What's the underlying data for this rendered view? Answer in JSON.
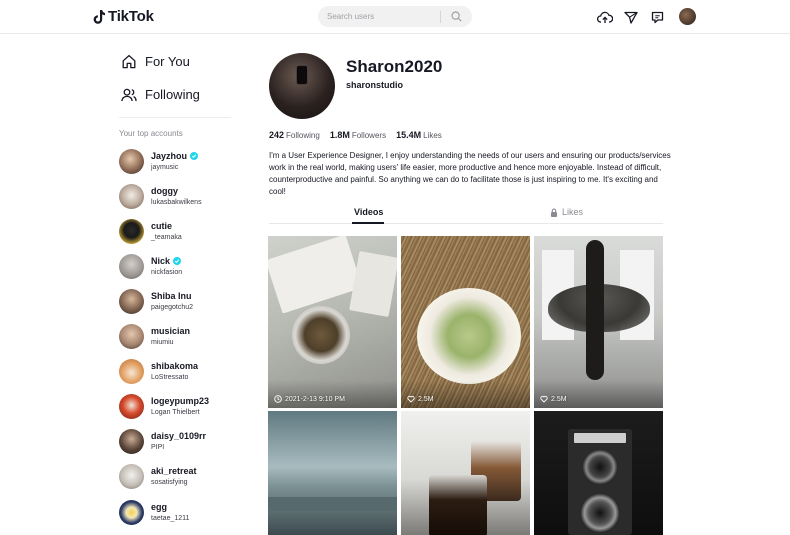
{
  "header": {
    "logo_text": "TikTok",
    "search_placeholder": "Search users",
    "icons": [
      "upload-icon",
      "inbox-send-icon",
      "messages-icon"
    ]
  },
  "sidebar": {
    "nav": [
      {
        "label": "For You",
        "icon": "home-icon"
      },
      {
        "label": "Following",
        "icon": "following-icon"
      }
    ],
    "top_accounts_title": "Your top accounts",
    "accounts": [
      {
        "name": "Jayzhou",
        "handle": "jaymusic",
        "verified": true
      },
      {
        "name": "doggy",
        "handle": "lukasbakwilkens",
        "verified": false
      },
      {
        "name": "cutie",
        "handle": "_teamaka",
        "verified": false
      },
      {
        "name": "Nick",
        "handle": "nickfasion",
        "verified": true
      },
      {
        "name": "Shiba Inu",
        "handle": "paigegotchu2",
        "verified": false
      },
      {
        "name": "musician",
        "handle": "miumiu",
        "verified": false
      },
      {
        "name": "shibakoma",
        "handle": "LoStressato",
        "verified": false
      },
      {
        "name": "logeypump23",
        "handle": "Logan Thielbert",
        "verified": false
      },
      {
        "name": "daisy_0109rr",
        "handle": "PIPI",
        "verified": false
      },
      {
        "name": "aki_retreat",
        "handle": "sosatisfying",
        "verified": false
      },
      {
        "name": "egg",
        "handle": "taetae_1211",
        "verified": false
      }
    ]
  },
  "profile": {
    "display_name": "Sharon2020",
    "username": "sharonstudio",
    "stats": {
      "following_count": "242",
      "following_label": "Following",
      "followers_count": "1.8M",
      "followers_label": "Followers",
      "likes_count": "15.4M",
      "likes_label": "Likes"
    },
    "bio": "I'm a User Experience Designer, I enjoy understanding the needs of our users and ensuring our products/services work in the real world, making users' life easier, more productive and hence more enjoyable. Instead of difficult, counterproductive and painful. So anything we can do to facilitate those is just inspiring to me. It's exciting and cool!",
    "tabs": {
      "videos": "Videos",
      "likes": "Likes"
    }
  },
  "videos": [
    {
      "overlay": "2021-2-13 9:10 PM",
      "overlay_icon": "clock-icon"
    },
    {
      "overlay": "2.5M",
      "overlay_icon": "heart-icon"
    },
    {
      "overlay": "2.5M",
      "overlay_icon": "heart-icon"
    },
    {
      "overlay": "",
      "overlay_icon": ""
    },
    {
      "overlay": "",
      "overlay_icon": ""
    },
    {
      "overlay": "",
      "overlay_icon": ""
    }
  ],
  "colors": {
    "text_primary": "#161823",
    "text_secondary": "#8a8b91",
    "verified": "#20d5ec",
    "search_bg": "#f1f1f2"
  }
}
